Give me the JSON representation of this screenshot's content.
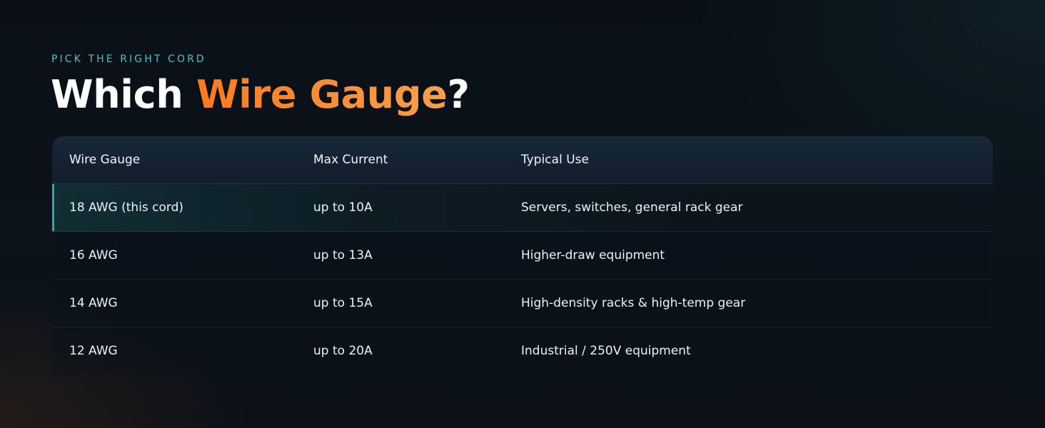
{
  "header": {
    "eyebrow": "PICK THE RIGHT CORD",
    "title_prefix": "Which ",
    "title_accent": "Wire Gauge",
    "title_suffix": "?"
  },
  "table": {
    "columns": [
      "Wire Gauge",
      "Max Current",
      "Typical Use"
    ],
    "rows": [
      {
        "gauge": "18 AWG (this cord)",
        "current": "up to 10A",
        "use": "Servers, switches, general rack gear",
        "highlighted": true
      },
      {
        "gauge": "16 AWG",
        "current": "up to 13A",
        "use": "Higher-draw equipment",
        "highlighted": false
      },
      {
        "gauge": "14 AWG",
        "current": "up to 15A",
        "use": "High-density racks & high-temp gear",
        "highlighted": false
      },
      {
        "gauge": "12 AWG",
        "current": "up to 20A",
        "use": "Industrial / 250V equipment",
        "highlighted": false
      }
    ]
  },
  "colors": {
    "accent_orange": "#ff7a1a",
    "accent_teal": "#3fc6d1",
    "highlight_bar": "#2fa9a8"
  }
}
